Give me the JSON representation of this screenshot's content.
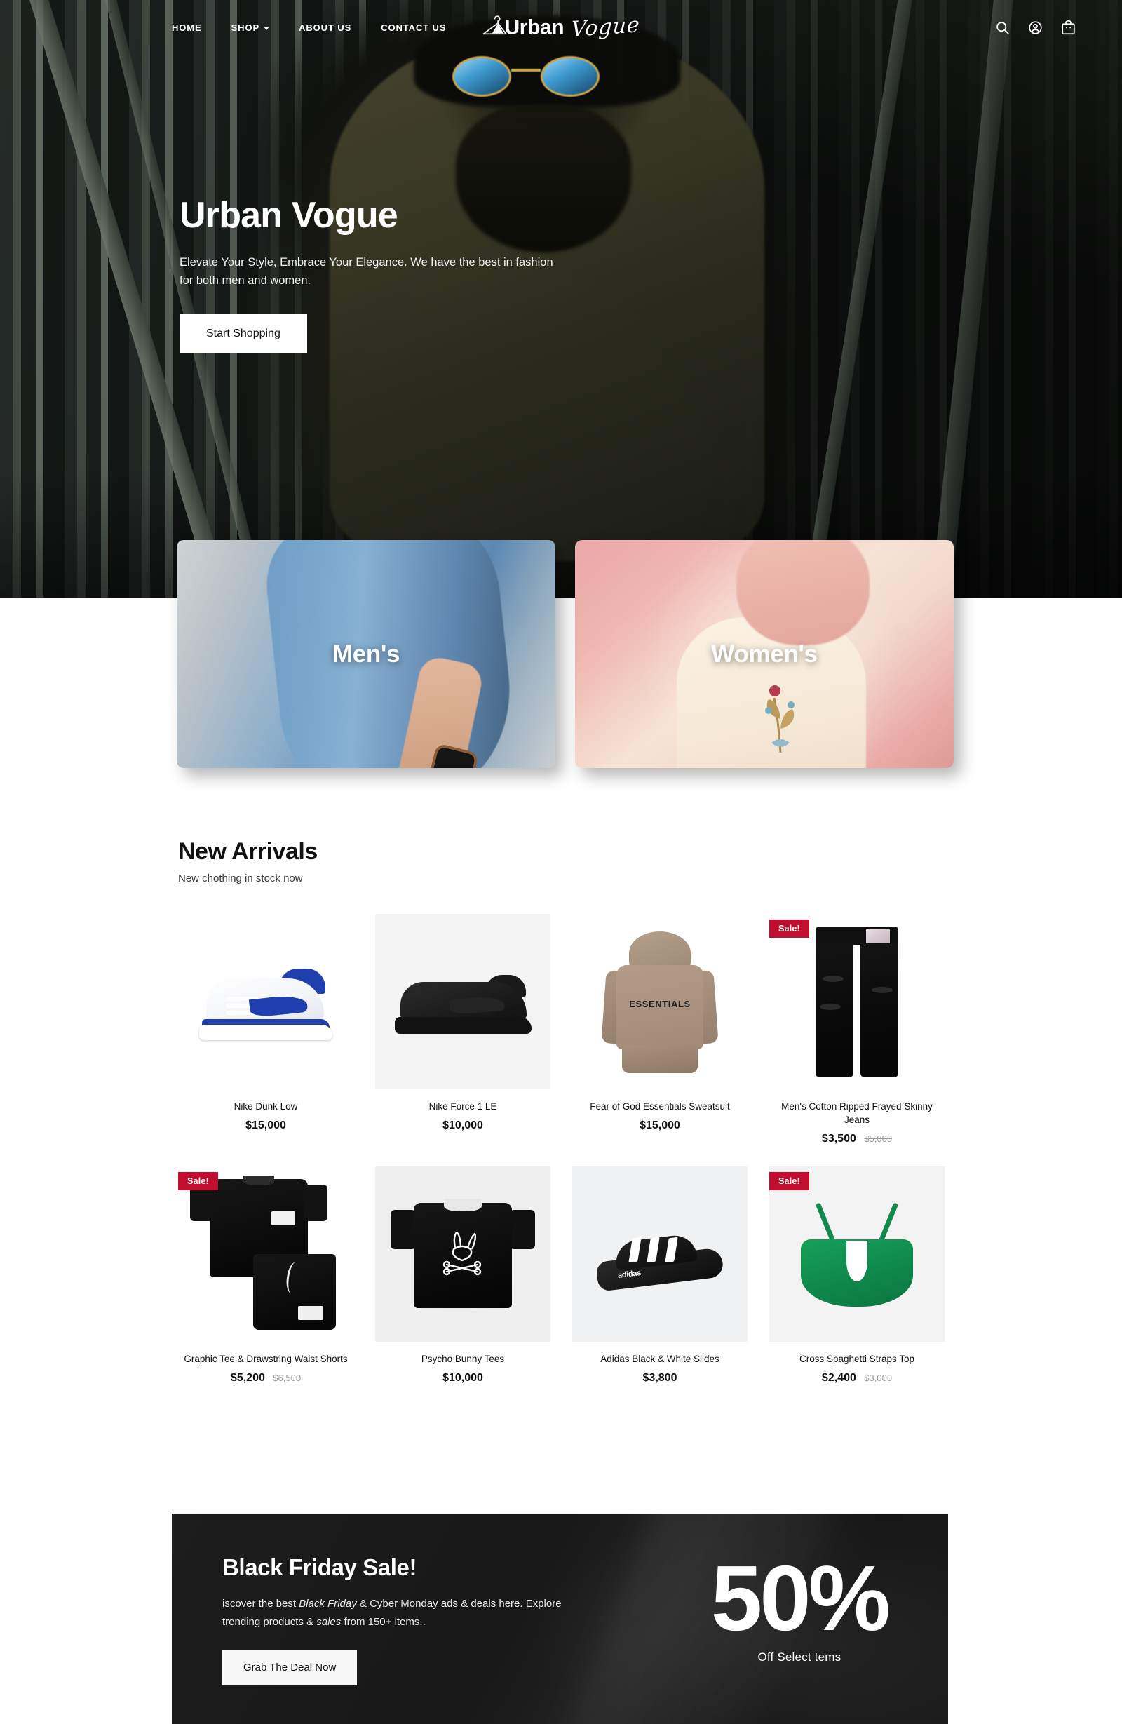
{
  "nav": {
    "links": [
      {
        "label": "HOME",
        "has_dropdown": false
      },
      {
        "label": "SHOP",
        "has_dropdown": true
      },
      {
        "label": "ABOUT US",
        "has_dropdown": false
      },
      {
        "label": "CONTACT US",
        "has_dropdown": false
      }
    ],
    "logo": {
      "primary": "Urban",
      "script": "Vogue",
      "icon": "hanger-icon"
    },
    "icons": [
      "search-icon",
      "account-icon",
      "cart-icon"
    ]
  },
  "hero": {
    "title": "Urban Vogue",
    "subtitle": "Elevate Your Style, Embrace Your Elegance. We have the best in fashion for both men and women.",
    "cta": "Start Shopping"
  },
  "categories": [
    {
      "label": "Men's"
    },
    {
      "label": "Women's"
    }
  ],
  "arrivals": {
    "title": "New Arrivals",
    "subtitle": "New chothing in stock now",
    "badge_label": "Sale!",
    "products": [
      {
        "name": "Nike Dunk Low",
        "price": "$15,000",
        "old_price": "",
        "on_sale": false
      },
      {
        "name": "Nike Force 1 LE",
        "price": "$10,000",
        "old_price": "",
        "on_sale": false
      },
      {
        "name": "Fear of God Essentials Sweatsuit",
        "price": "$15,000",
        "old_price": "",
        "on_sale": false
      },
      {
        "name": "Men's Cotton Ripped Frayed Skinny Jeans",
        "price": "$3,500",
        "old_price": "$5,000",
        "on_sale": true
      },
      {
        "name": "Graphic Tee & Drawstring Waist Shorts",
        "price": "$5,200",
        "old_price": "$6,500",
        "on_sale": true
      },
      {
        "name": "Psycho Bunny Tees",
        "price": "$10,000",
        "old_price": "",
        "on_sale": false
      },
      {
        "name": "Adidas Black & White Slides",
        "price": "$3,800",
        "old_price": "",
        "on_sale": false
      },
      {
        "name": "Cross Spaghetti Straps Top",
        "price": "$2,400",
        "old_price": "$3,000",
        "on_sale": true
      }
    ]
  },
  "black_friday": {
    "title": "Black Friday Sale!",
    "text_part1": "iscover the best ",
    "text_em1": "Black Friday",
    "text_part2": " & Cyber Monday ads & deals here. Explore trending products & ",
    "text_em2": "sales",
    "text_part3": " from 150+ items..",
    "cta": "Grab The Deal Now",
    "percent": "50%",
    "percent_caption": "Off Select tems"
  },
  "colors": {
    "sale_badge": "#c20e2e",
    "banner_bg": "#1b1b1b",
    "accent_text": "#111111"
  },
  "hoodie_graphic": "ESSENTIALS",
  "slide_graphic": "adidas"
}
